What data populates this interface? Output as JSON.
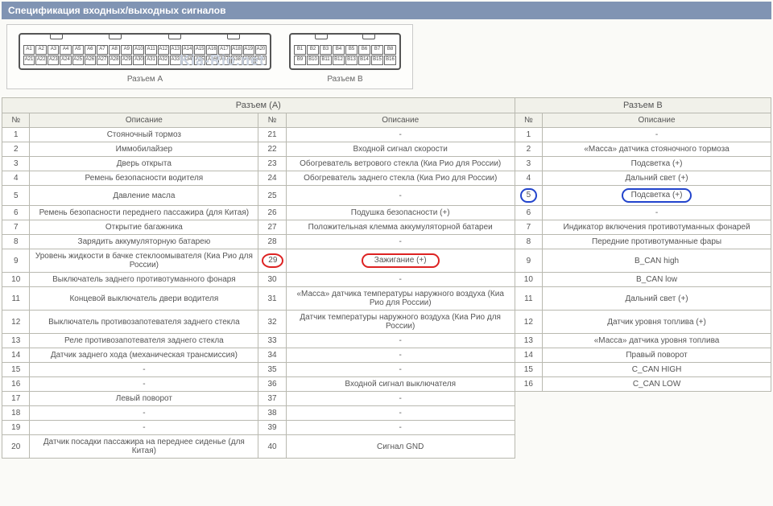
{
  "title": "Спецификация входных/выходных сигналов",
  "watermark": "Kia-Rio.net",
  "connectorA": {
    "label": "Разъем А",
    "pins_row1": [
      "A1",
      "A2",
      "A3",
      "A4",
      "A5",
      "A6",
      "A7",
      "A8",
      "A9",
      "A10",
      "A11",
      "A12",
      "A13",
      "A14",
      "A15",
      "A16",
      "A17",
      "A18",
      "A19",
      "A20"
    ],
    "pins_row2": [
      "A21",
      "A22",
      "A23",
      "A24",
      "A25",
      "A26",
      "A27",
      "A28",
      "A29",
      "A30",
      "A31",
      "A32",
      "A33",
      "A34",
      "A35",
      "A36",
      "A37",
      "A38",
      "A39",
      "A40"
    ]
  },
  "connectorB": {
    "label": "Разъем B",
    "pins_row1": [
      "B1",
      "B2",
      "B3",
      "B4",
      "B5",
      "B6",
      "B7",
      "B8"
    ],
    "pins_row2": [
      "B9",
      "B10",
      "B11",
      "B12",
      "B13",
      "B14",
      "B15",
      "B16"
    ]
  },
  "headers": {
    "groupA": "Разъем (А)",
    "groupB": "Разъем B",
    "num": "№",
    "desc": "Описание"
  },
  "rows": [
    {
      "a1n": "1",
      "a1d": "Стояночный тормоз",
      "a2n": "21",
      "a2d": "-",
      "bn": "1",
      "bd": "-"
    },
    {
      "a1n": "2",
      "a1d": "Иммобилайзер",
      "a2n": "22",
      "a2d": "Входной сигнал скорости",
      "bn": "2",
      "bd": "«Масса» датчика стояночного тормоза"
    },
    {
      "a1n": "3",
      "a1d": "Дверь открыта",
      "a2n": "23",
      "a2d": "Обогреватель ветрового стекла (Киа Рио для России)",
      "bn": "3",
      "bd": "Подсветка (+)"
    },
    {
      "a1n": "4",
      "a1d": "Ремень безопасности водителя",
      "a2n": "24",
      "a2d": "Обогреватель заднего стекла (Киа Рио для России)",
      "bn": "4",
      "bd": "Дальний свет (+)"
    },
    {
      "a1n": "5",
      "a1d": "Давление масла",
      "a2n": "25",
      "a2d": "-",
      "bn": "5",
      "bd": "Подсветка (+)",
      "hlB": "blue"
    },
    {
      "a1n": "6",
      "a1d": "Ремень безопасности переднего пассажира (для Китая)",
      "a2n": "26",
      "a2d": "Подушка безопасности (+)",
      "bn": "6",
      "bd": "-"
    },
    {
      "a1n": "7",
      "a1d": "Открытие багажника",
      "a2n": "27",
      "a2d": "Положительная клемма аккумуляторной батареи",
      "bn": "7",
      "bd": "Индикатор включения противотуманных фонарей"
    },
    {
      "a1n": "8",
      "a1d": "Зарядить аккумуляторную батарею",
      "a2n": "28",
      "a2d": "-",
      "bn": "8",
      "bd": "Передние противотуманные фары"
    },
    {
      "a1n": "9",
      "a1d": "Уровень жидкости в бачке стеклоомывателя (Киа Рио для России)",
      "a2n": "29",
      "a2d": "Зажигание (+)",
      "bn": "9",
      "bd": "B_CAN high",
      "hlA2": "red"
    },
    {
      "a1n": "10",
      "a1d": "Выключатель заднего противотуманного фонаря",
      "a2n": "30",
      "a2d": "-",
      "bn": "10",
      "bd": "B_CAN low"
    },
    {
      "a1n": "11",
      "a1d": "Концевой выключатель двери водителя",
      "a2n": "31",
      "a2d": "«Масса» датчика температуры наружного воздуха (Киа Рио для России)",
      "bn": "11",
      "bd": "Дальний свет (+)"
    },
    {
      "a1n": "12",
      "a1d": "Выключатель противозапотевателя заднего стекла",
      "a2n": "32",
      "a2d": "Датчик температуры наружного воздуха (Киа Рио для России)",
      "bn": "12",
      "bd": "Датчик уровня топлива (+)"
    },
    {
      "a1n": "13",
      "a1d": "Реле противозапотевателя заднего стекла",
      "a2n": "33",
      "a2d": "-",
      "bn": "13",
      "bd": "«Масса» датчика уровня топлива"
    },
    {
      "a1n": "14",
      "a1d": "Датчик заднего хода (механическая трансмиссия)",
      "a2n": "34",
      "a2d": "-",
      "bn": "14",
      "bd": "Правый поворот"
    },
    {
      "a1n": "15",
      "a1d": "-",
      "a2n": "35",
      "a2d": "-",
      "bn": "15",
      "bd": "C_CAN HIGH"
    },
    {
      "a1n": "16",
      "a1d": "-",
      "a2n": "36",
      "a2d": "Входной сигнал выключателя",
      "bn": "16",
      "bd": "C_CAN LOW"
    },
    {
      "a1n": "17",
      "a1d": "Левый поворот",
      "a2n": "37",
      "a2d": "-"
    },
    {
      "a1n": "18",
      "a1d": "-",
      "a2n": "38",
      "a2d": "-"
    },
    {
      "a1n": "19",
      "a1d": "-",
      "a2n": "39",
      "a2d": "-"
    },
    {
      "a1n": "20",
      "a1d": "Датчик посадки пассажира на переднее сиденье (для Китая)",
      "a2n": "40",
      "a2d": "Сигнал GND"
    }
  ]
}
